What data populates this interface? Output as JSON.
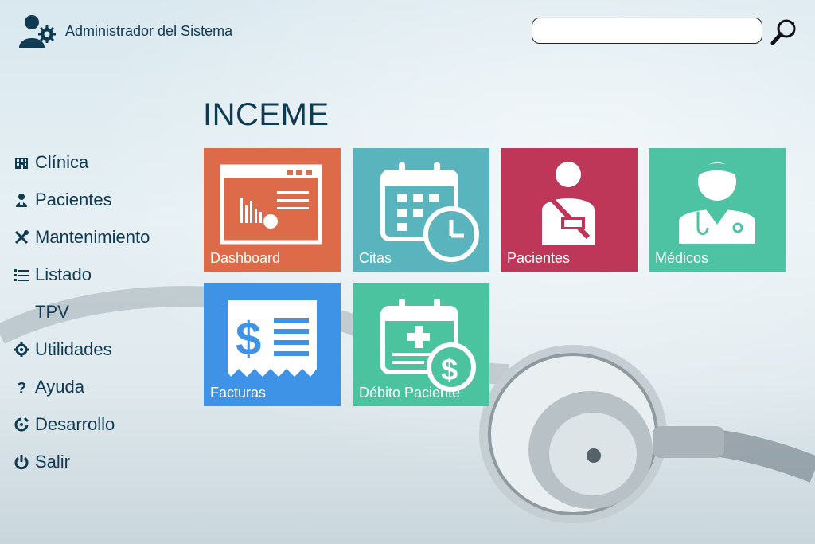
{
  "header": {
    "user_label": "Administrador del Sistema",
    "search_placeholder": "",
    "search_value": ""
  },
  "main": {
    "title": "INCEME"
  },
  "sidebar": {
    "items": [
      {
        "label": "Clínica",
        "icon": "building-icon"
      },
      {
        "label": "Pacientes",
        "icon": "patient-icon"
      },
      {
        "label": "Mantenimiento",
        "icon": "tools-icon"
      },
      {
        "label": "Listado",
        "icon": "list-icon"
      },
      {
        "label": "TPV",
        "icon": ""
      },
      {
        "label": "Utilidades",
        "icon": "gear-icon"
      },
      {
        "label": "Ayuda",
        "icon": "question-icon"
      },
      {
        "label": "Desarrollo",
        "icon": "dev-gear-icon"
      },
      {
        "label": "Salir",
        "icon": "power-icon"
      }
    ]
  },
  "tiles": [
    {
      "label": "Dashboard",
      "color": "#dd6a48",
      "icon": "dashboard-icon"
    },
    {
      "label": "Citas",
      "color": "#5ab4bd",
      "icon": "calendar-clock-icon"
    },
    {
      "label": "Pacientes",
      "color": "#be3658",
      "icon": "injured-patient-icon"
    },
    {
      "label": "Médicos",
      "color": "#4ec3a3",
      "icon": "doctor-icon"
    },
    {
      "label": "Facturas",
      "color": "#3f93e6",
      "icon": "invoice-icon"
    },
    {
      "label": "Débito Paciente",
      "color": "#4ac39e",
      "icon": "calendar-dollar-icon"
    }
  ],
  "colors": {
    "text": "#0e3a52"
  }
}
